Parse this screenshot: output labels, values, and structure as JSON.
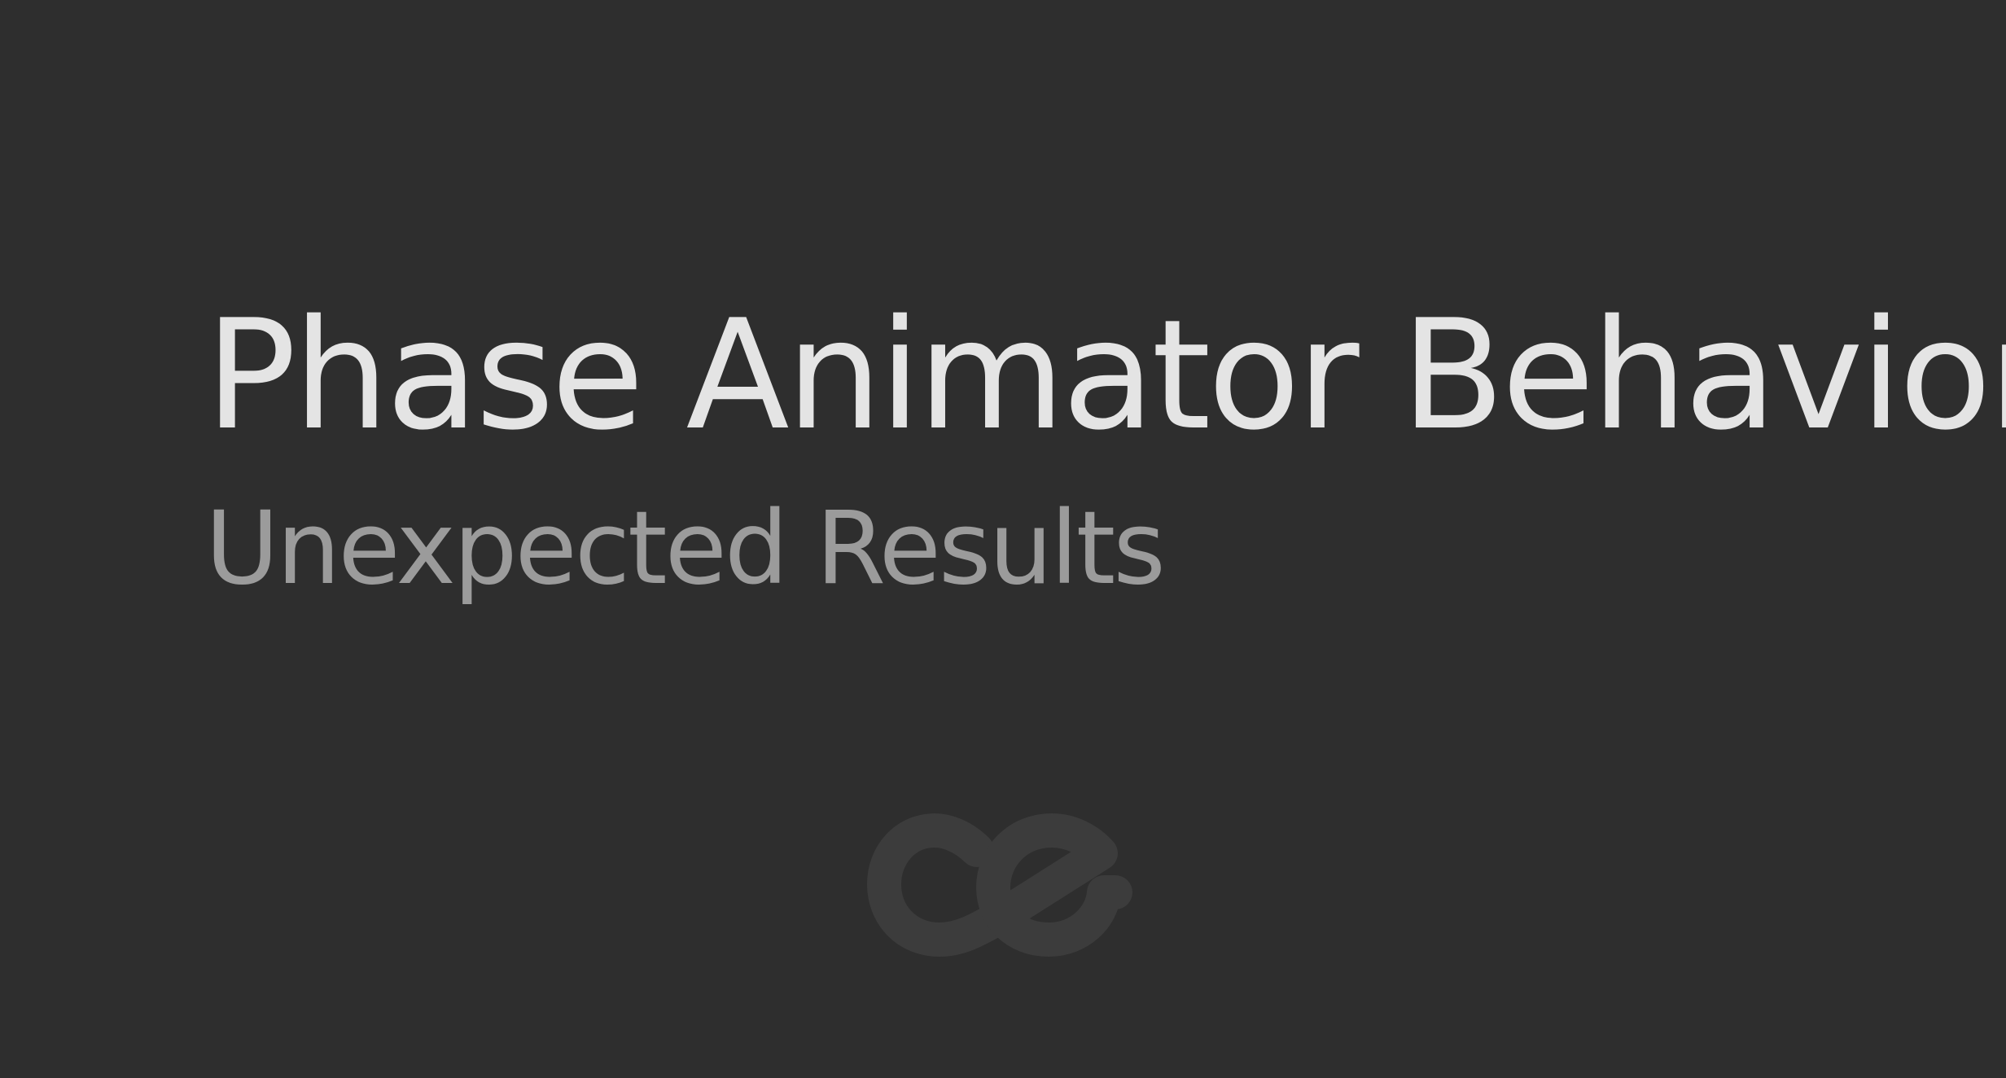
{
  "slide": {
    "title": "Phase Animator Behavior",
    "subtitle": "Unexpected Results",
    "logo_icon": "ce-logo-icon"
  },
  "colors": {
    "background": "#2e2e2e",
    "title": "#e4e4e4",
    "subtitle": "#9b9b9b",
    "logo": "#3c3c3c"
  }
}
